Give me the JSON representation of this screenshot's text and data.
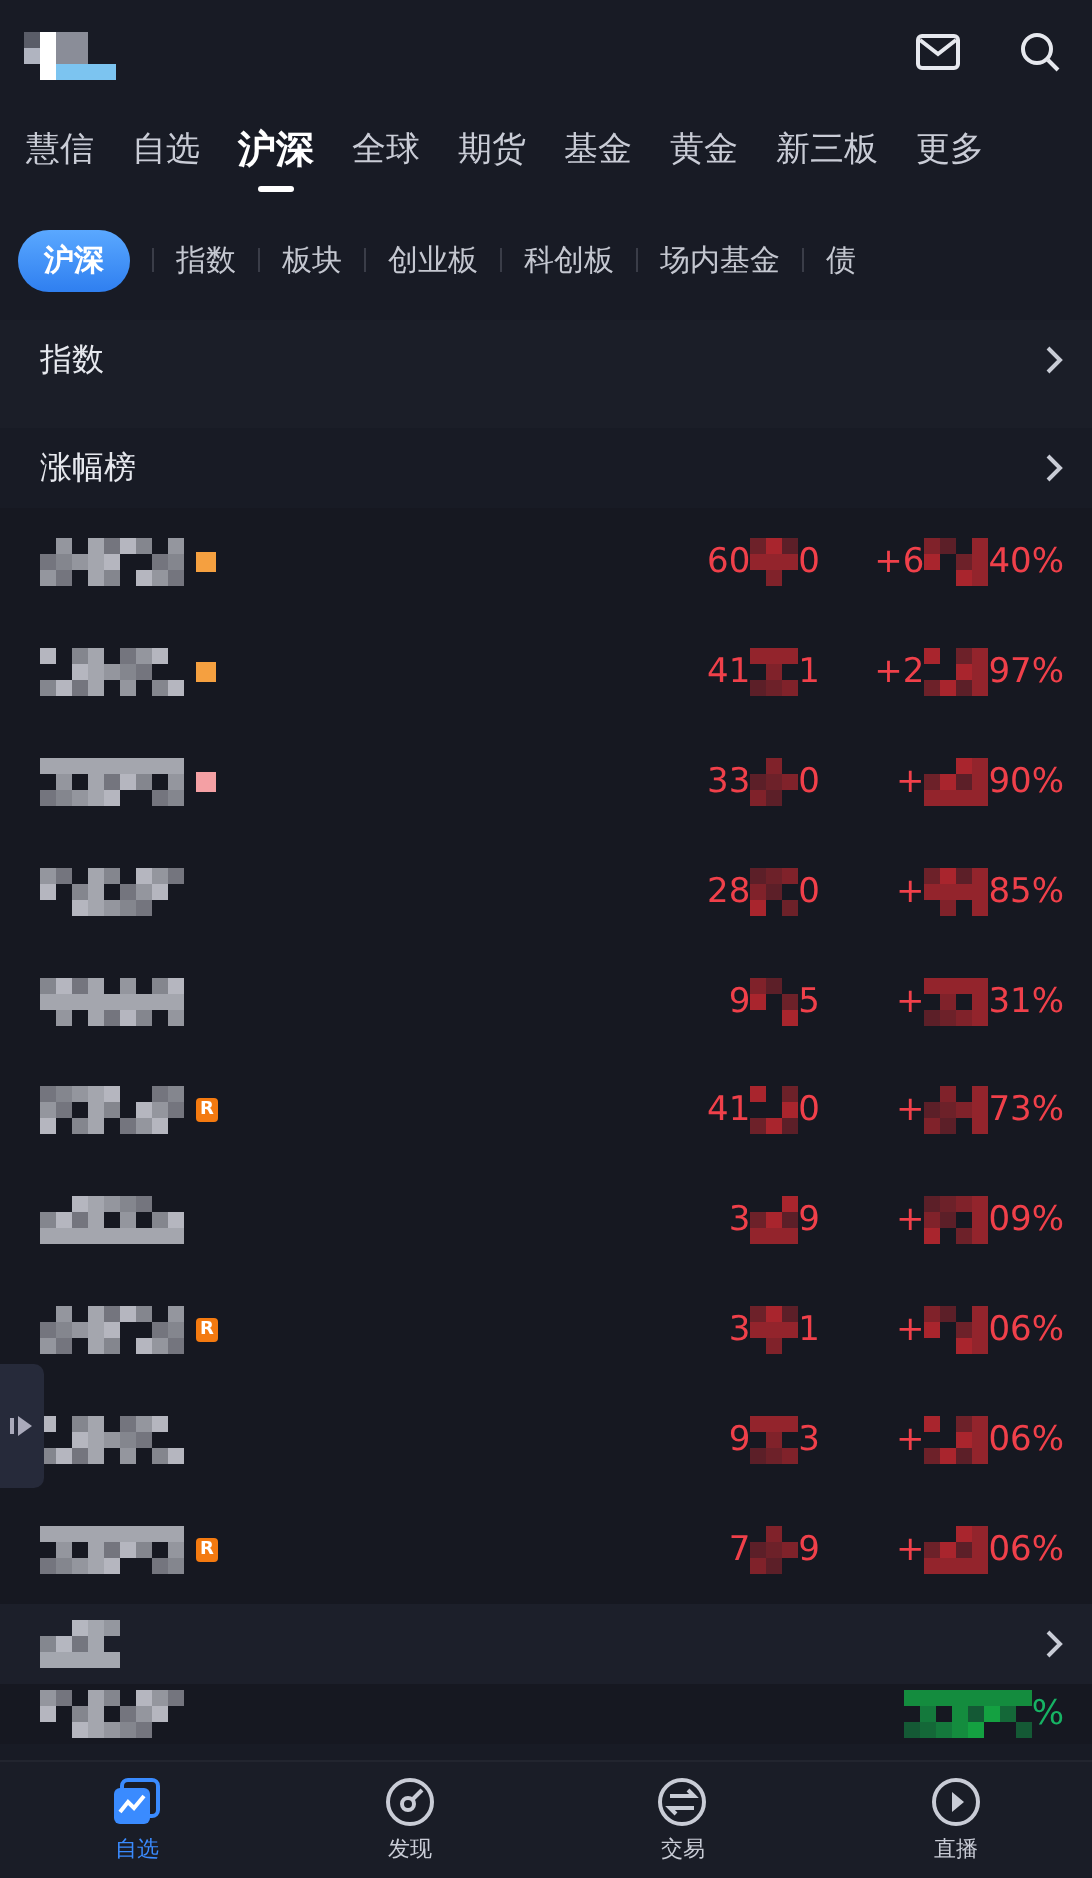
{
  "tabs": [
    {
      "label": "慧信",
      "selected": false
    },
    {
      "label": "自选",
      "selected": false
    },
    {
      "label": "沪深",
      "selected": true
    },
    {
      "label": "全球",
      "selected": false
    },
    {
      "label": "期货",
      "selected": false
    },
    {
      "label": "基金",
      "selected": false
    },
    {
      "label": "黄金",
      "selected": false
    },
    {
      "label": "新三板",
      "selected": false
    },
    {
      "label": "更多",
      "selected": false
    }
  ],
  "subtabs": [
    {
      "label": "沪深",
      "selected": true
    },
    {
      "label": "指数",
      "selected": false
    },
    {
      "label": "板块",
      "selected": false
    },
    {
      "label": "创业板",
      "selected": false
    },
    {
      "label": "科创板",
      "selected": false
    },
    {
      "label": "场内基金",
      "selected": false
    },
    {
      "label": "债",
      "selected": false
    }
  ],
  "index_section": {
    "title": "指数"
  },
  "gainers_section": {
    "title": "涨幅榜"
  },
  "rows": [
    {
      "price_start": "60",
      "price_end": "0",
      "change_start": "+6",
      "change_end": "40%",
      "tag": {
        "kind": "square",
        "color": "#f5a040"
      }
    },
    {
      "price_start": "41",
      "price_end": "1",
      "change_start": "+2",
      "change_end": "97%",
      "tag": {
        "kind": "square",
        "color": "#f5a040"
      }
    },
    {
      "price_start": "33",
      "price_end": "0",
      "change_start": "+",
      "change_end": "90%",
      "tag": {
        "kind": "square",
        "color": "#f4a0a4"
      }
    },
    {
      "price_start": "28",
      "price_end": "0",
      "change_start": "+",
      "change_end": "85%"
    },
    {
      "price_start": "9",
      "price_end": "5",
      "change_start": "+",
      "change_end": "31%"
    },
    {
      "price_start": "41",
      "price_end": "0",
      "change_start": "+",
      "change_end": "73%",
      "tag": {
        "kind": "badge",
        "label": "R"
      }
    },
    {
      "price_start": "3",
      "price_end": "9",
      "change_start": "+",
      "change_end": "09%"
    },
    {
      "price_start": "3",
      "price_end": "1",
      "change_start": "+",
      "change_end": "06%",
      "tag": {
        "kind": "badge",
        "label": "R"
      }
    },
    {
      "price_start": "9",
      "price_end": "3",
      "change_start": "+",
      "change_end": "06%"
    },
    {
      "price_start": "7",
      "price_end": "9",
      "change_start": "+",
      "change_end": "06%",
      "tag": {
        "kind": "badge",
        "label": "R"
      }
    }
  ],
  "next_row": {
    "change_end": "%"
  },
  "bottom_nav": [
    {
      "label": "自选",
      "selected": true
    },
    {
      "label": "发现",
      "selected": false
    },
    {
      "label": "交易",
      "selected": false
    },
    {
      "label": "直播",
      "selected": false
    }
  ]
}
